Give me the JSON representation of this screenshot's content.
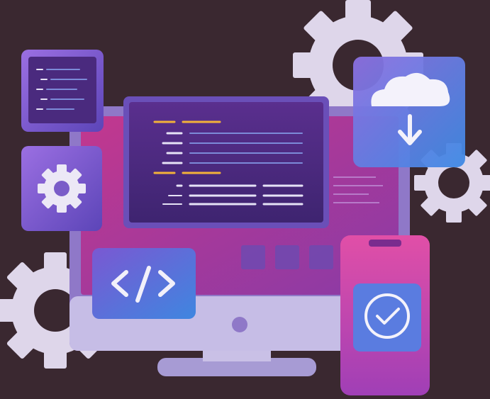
{
  "illustration": {
    "background": "#3a2830",
    "palette": {
      "gear": "#ded6ea",
      "monitor_frame": "#8f78c8",
      "monitor_screen": "#b23a8e",
      "monitor_base": "#b9b0dc",
      "code_panel": "#4a2a7e",
      "code_yellow": "#f2b23a",
      "code_line": "#d6d2f0",
      "tile_blue": "#4f73d6",
      "tile_purple": "#7a4cc9",
      "phone_body": "#d24aa6",
      "check_tile": "#5a7ce0"
    },
    "icons": [
      "gear-icon",
      "code-brackets-icon",
      "cloud-download-icon",
      "check-circle-icon",
      "document-lines-icon"
    ]
  }
}
